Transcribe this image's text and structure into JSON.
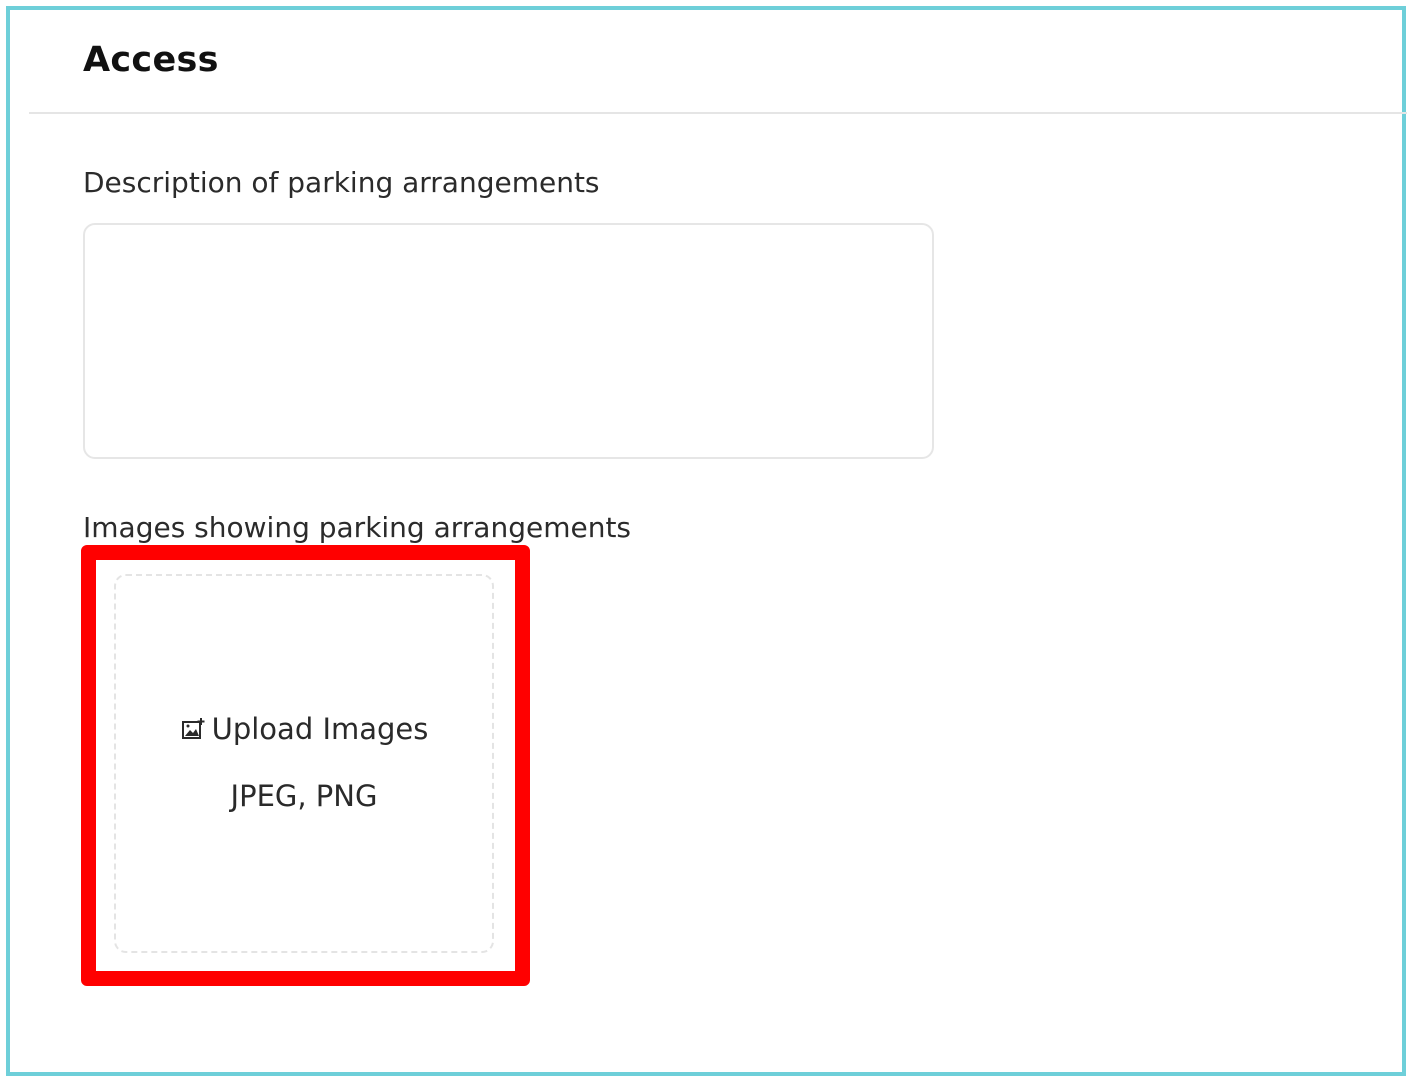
{
  "section": {
    "title": "Access"
  },
  "fields": {
    "description": {
      "label": "Description of parking arrangements",
      "value": "",
      "placeholder": ""
    },
    "images": {
      "label": "Images showing parking arrangements",
      "upload_label": "Upload Images",
      "upload_icon": "image-add-icon",
      "formats": "JPEG, PNG"
    }
  },
  "colors": {
    "frame_border": "#6ecfd9",
    "highlight": "#ff0000",
    "text": "#2a2a2a"
  }
}
